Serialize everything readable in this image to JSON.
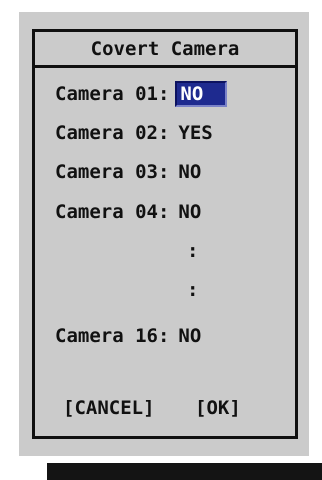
{
  "dialog": {
    "title": "Covert Camera"
  },
  "cameras": [
    {
      "label": "Camera 01:",
      "value": "NO",
      "selected": true
    },
    {
      "label": "Camera 02:",
      "value": "YES"
    },
    {
      "label": "Camera 03:",
      "value": "NO"
    },
    {
      "label": "Camera 04:",
      "value": "NO"
    },
    {
      "label": "Camera 16:",
      "value": "NO"
    }
  ],
  "ellipsis": [
    ":",
    ":"
  ],
  "buttons": {
    "cancel": "[CANCEL]",
    "ok": "[OK]"
  },
  "colors": {
    "panel": "#cbcbcb",
    "border": "#101010",
    "selection": "#1e2a8f",
    "shadow": "#141414"
  }
}
